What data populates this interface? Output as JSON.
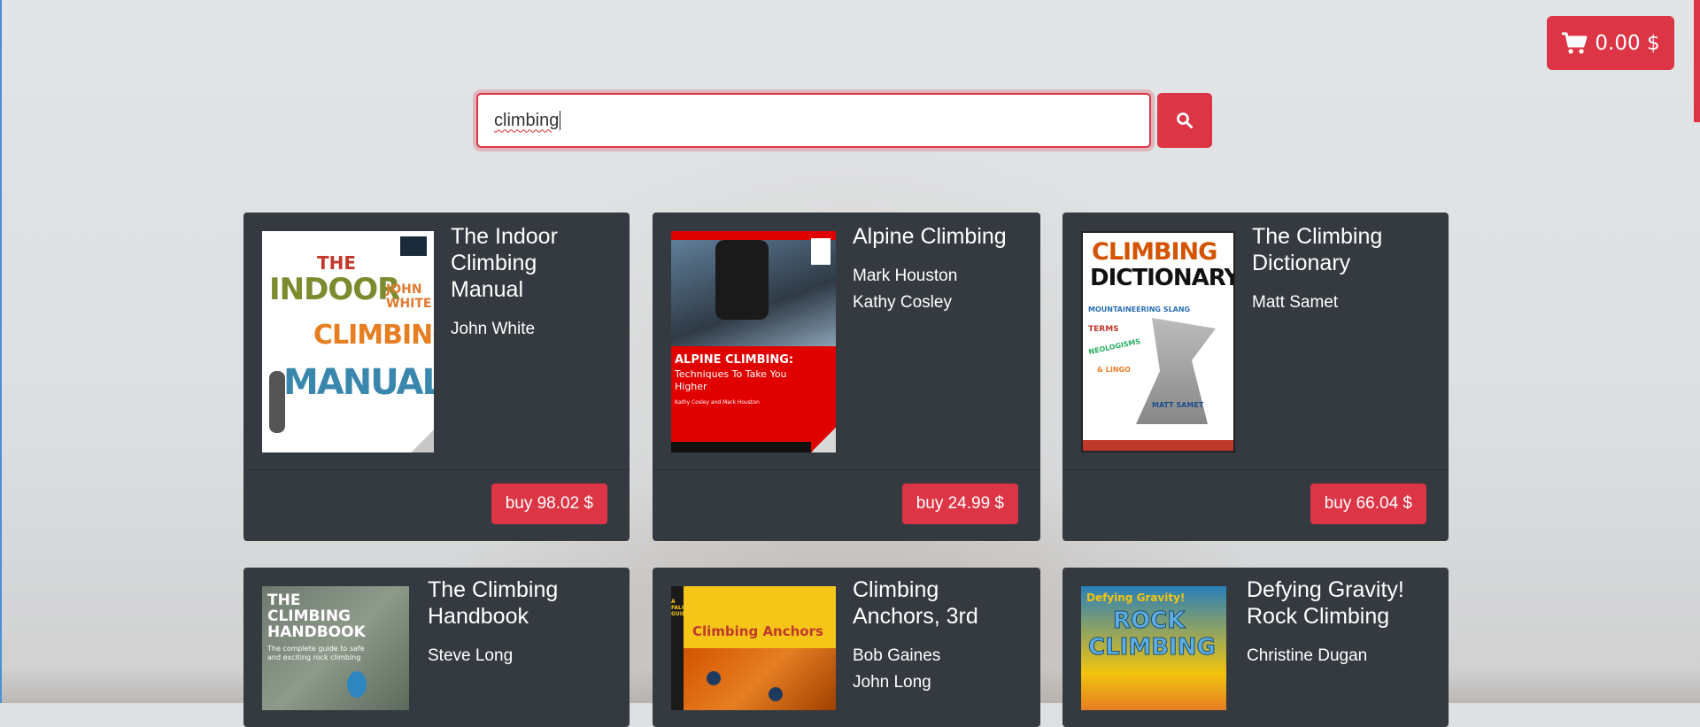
{
  "cart": {
    "total": "0.00 $",
    "icon": "shopping-cart-icon"
  },
  "search": {
    "value": "climbing",
    "button_icon": "search-icon"
  },
  "books": [
    {
      "title_lines": [
        "The Indoor",
        "Climbing",
        "Manual"
      ],
      "authors": [
        "John White"
      ],
      "buy_label": "buy 98.02 $",
      "cover": {
        "lines": [
          "THE",
          "INDOOR",
          "CLIMBING",
          "MANUAL"
        ],
        "author": "JOHN WHITE"
      }
    },
    {
      "title_lines": [
        "Alpine Climbing"
      ],
      "authors": [
        "Mark Houston",
        "Kathy Cosley"
      ],
      "buy_label": "buy 24.99 $",
      "cover": {
        "headline": "ALPINE CLIMBING:",
        "subtitle": "Techniques To Take You Higher",
        "byline": "Kathy Cosley and Mark Houston"
      }
    },
    {
      "title_lines": [
        "The Climbing",
        "Dictionary"
      ],
      "authors": [
        "Matt Samet"
      ],
      "buy_label": "buy 66.04 $",
      "cover": {
        "lines": [
          "CLIMBING",
          "DICTIONARY"
        ],
        "tags": [
          "MOUNTAINEERING SLANG",
          "TERMS",
          "NEOLOGISMS",
          "& LINGO"
        ],
        "author": "MATT SAMET"
      }
    },
    {
      "title_lines": [
        "The Climbing",
        "Handbook"
      ],
      "authors": [
        "Steve Long"
      ],
      "buy_label": "",
      "cover": {
        "lines": [
          "THE",
          "CLIMBING",
          "HANDBOOK"
        ],
        "tagline": "The complete guide to safe and exciting rock climbing"
      }
    },
    {
      "title_lines": [
        "Climbing",
        "Anchors, 3rd"
      ],
      "authors": [
        "Bob Gaines",
        "John Long"
      ],
      "buy_label": "",
      "cover": {
        "series": "A FALCON GUIDE",
        "headline": "Climbing Anchors"
      }
    },
    {
      "title_lines": [
        "Defying Gravity!",
        "Rock Climbing"
      ],
      "authors": [
        "Christine Dugan"
      ],
      "buy_label": "",
      "cover": {
        "lines": [
          "Defying Gravity!",
          "ROCK",
          "CLIMBING"
        ]
      }
    }
  ],
  "colors": {
    "accent": "#dc3545",
    "card": "#343a40",
    "background": "#dde0e3"
  }
}
